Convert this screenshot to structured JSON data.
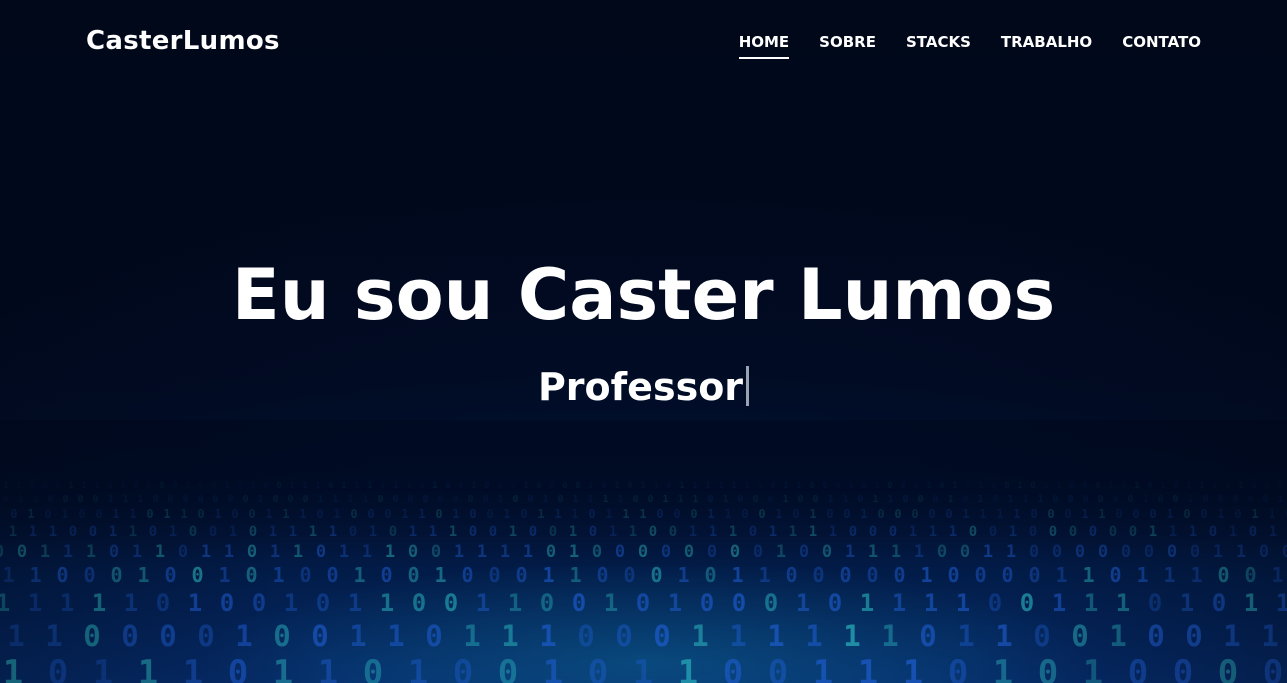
{
  "header": {
    "logo": "CasterLumos",
    "nav": [
      {
        "label": "HOME",
        "active": true
      },
      {
        "label": "SOBRE",
        "active": false
      },
      {
        "label": "STACKS",
        "active": false
      },
      {
        "label": "TRABALHO",
        "active": false
      },
      {
        "label": "CONTATO",
        "active": false
      }
    ]
  },
  "hero": {
    "title": "Eu sou Caster Lumos",
    "typed_text": "Professor",
    "background": "binary-code-floor"
  },
  "colors": {
    "background": "#000a23",
    "text": "#ffffff",
    "binary_blue": "#1f5fd6",
    "binary_cyan": "#2fc3c8",
    "cursor": "#9aa3b4"
  }
}
